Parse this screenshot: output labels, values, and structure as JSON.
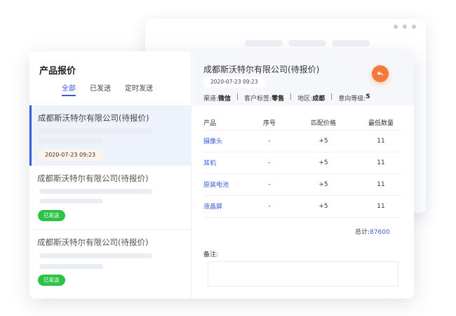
{
  "list": {
    "title": "产品报价",
    "tabs": [
      "全部",
      "已发送",
      "定时发送"
    ],
    "items": [
      {
        "company": "成都斯沃特尔有限公司(待报价)",
        "date": "2020-07-23  09:23"
      },
      {
        "company": "成都斯沃特尔有限公司(待报价)",
        "status": "已发送"
      },
      {
        "company": "成都斯沃特尔有限公司(待报价)",
        "status": "已发送"
      }
    ]
  },
  "detail": {
    "company": "成都斯沃特尔有限公司(待报价)",
    "date": "2020-07-23  09:23",
    "meta": {
      "channel_label": "渠道:",
      "channel": "微信",
      "tag_label": "客户标签:",
      "tag": "零售",
      "region_label": "地区:",
      "region": "成都",
      "intent_label": "意向等级:",
      "intent": "5"
    },
    "table": {
      "headers": [
        "产品",
        "序号",
        "匹配价格",
        "最低数量"
      ],
      "rows": [
        [
          "摄像头",
          "-",
          "+5",
          "11"
        ],
        [
          "耳机",
          "-",
          "+5",
          "11"
        ],
        [
          "原装电池",
          "-",
          "+5",
          "11"
        ],
        [
          "液晶屏",
          "-",
          "+5",
          "11"
        ]
      ]
    },
    "total_label": "总计:",
    "total": "87600",
    "notes_label": "备注:"
  },
  "colors": {
    "accent": "#3a5bd9",
    "badge": "#2fc24a",
    "back_button": "#f7793a"
  },
  "icons": {
    "back": "reply-arrow-icon"
  }
}
